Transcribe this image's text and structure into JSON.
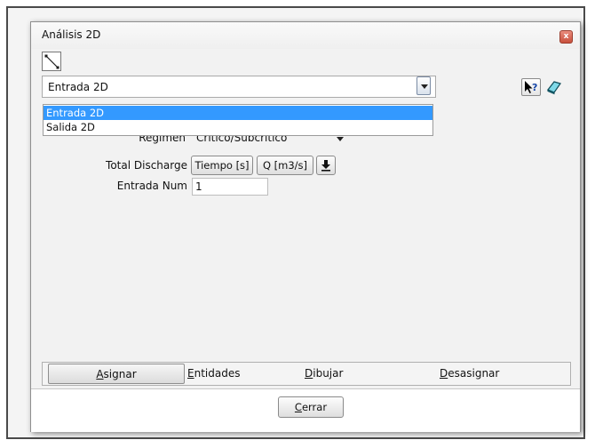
{
  "window": {
    "title": "Análisis 2D"
  },
  "combo": {
    "value": "Entrada 2D"
  },
  "dropdown": {
    "options": [
      "Entrada 2D",
      "Salida 2D"
    ],
    "selected": "Entrada 2D"
  },
  "form": {
    "regimen_label": "Regimen",
    "regimen_value": "Crítico/Subcrítico",
    "total_discharge_label": "Total Discharge",
    "tiempo_button": "Tiempo [s]",
    "q_button": "Q [m3/s]",
    "entrada_num_label": "Entrada Num",
    "entrada_num_value": "1"
  },
  "tabs": [
    {
      "first": "A",
      "rest": "signar"
    },
    {
      "first": "E",
      "rest": "ntidades"
    },
    {
      "first": "D",
      "rest": "ibujar"
    },
    {
      "first": "D",
      "rest": "esasignar"
    }
  ],
  "footer": {
    "cerrar_first": "C",
    "cerrar_rest": "errar"
  },
  "icons": [
    "line-tool-icon",
    "chevron-down-icon",
    "help-pointer-icon",
    "eraser-icon",
    "download-icon",
    "close-icon"
  ]
}
